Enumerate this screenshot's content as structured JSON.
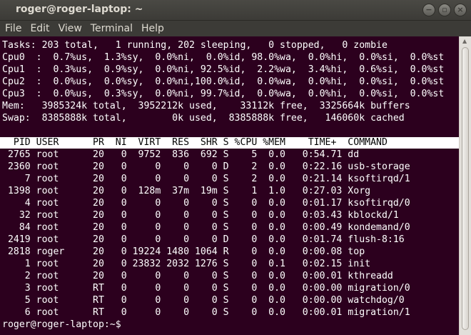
{
  "window": {
    "title": "roger@roger-laptop: ~"
  },
  "menu": [
    "File",
    "Edit",
    "View",
    "Terminal",
    "Help"
  ],
  "summary": [
    "Tasks: 203 total,   1 running, 202 sleeping,   0 stopped,   0 zombie",
    "Cpu0  :  0.7%us,  1.3%sy,  0.0%ni,  0.0%id, 98.0%wa,  0.0%hi,  0.0%si,  0.0%st",
    "Cpu1  :  0.3%us,  0.9%sy,  0.0%ni, 92.5%id,  2.2%wa,  3.4%hi,  0.6%si,  0.0%st",
    "Cpu2  :  0.0%us,  0.0%sy,  0.0%ni,100.0%id,  0.0%wa,  0.0%hi,  0.0%si,  0.0%st",
    "Cpu3  :  0.0%us,  0.3%sy,  0.0%ni, 99.7%id,  0.0%wa,  0.0%hi,  0.0%si,  0.0%st",
    "Mem:   3985324k total,  3952212k used,    33112k free,  3325664k buffers",
    "Swap:  8385888k total,        0k used,  8385888k free,   146060k cached"
  ],
  "table": {
    "header": "  PID USER      PR  NI  VIRT  RES  SHR S %CPU %MEM    TIME+  COMMAND",
    "rows": [
      " 2765 root      20   0  9752  836  692 S    5  0.0   0:54.71 dd",
      " 2360 root      20   0     0    0    0 D    2  0.0   0:22.16 usb-storage",
      "    7 root      20   0     0    0    0 S    2  0.0   0:21.14 ksoftirqd/1",
      " 1398 root      20   0  128m  37m  19m S    1  1.0   0:27.03 Xorg",
      "    4 root      20   0     0    0    0 S    0  0.0   0:01.17 ksoftirqd/0",
      "   32 root      20   0     0    0    0 S    0  0.0   0:03.43 kblockd/1",
      "   84 root      20   0     0    0    0 S    0  0.0   0:00.49 kondemand/0",
      " 2419 root      20   0     0    0    0 D    0  0.0   0:01.74 flush-8:16",
      " 2818 roger     20   0 19224 1480 1064 R    0  0.0   0:00.08 top",
      "    1 root      20   0 23832 2032 1276 S    0  0.1   0:02.15 init",
      "    2 root      20   0     0    0    0 S    0  0.0   0:00.01 kthreadd",
      "    3 root      RT   0     0    0    0 S    0  0.0   0:00.00 migration/0",
      "    5 root      RT   0     0    0    0 S    0  0.0   0:00.00 watchdog/0",
      "    6 root      RT   0     0    0    0 S    0  0.0   0:00.01 migration/1"
    ]
  },
  "prompt": "roger@roger-laptop:~$ "
}
